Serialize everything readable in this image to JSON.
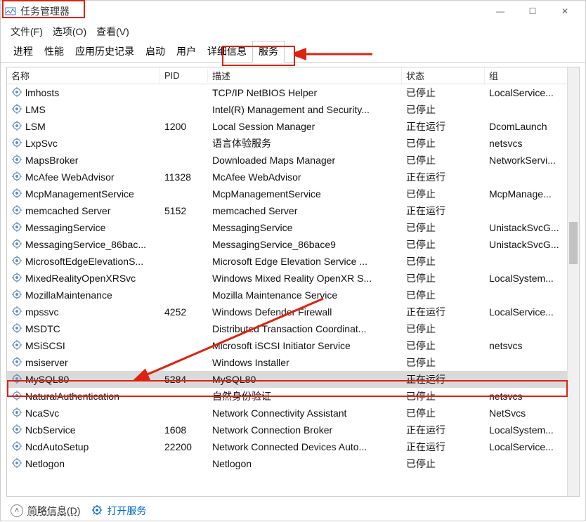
{
  "window": {
    "title": "任务管理器",
    "minimize": "—",
    "maximize": "☐",
    "close": "✕"
  },
  "menubar": {
    "file": "文件(F)",
    "options": "选项(O)",
    "view": "查看(V)"
  },
  "tabs": {
    "processes": "进程",
    "performance": "性能",
    "app_history": "应用历史记录",
    "startup": "启动",
    "users": "用户",
    "details": "详细信息",
    "services": "服务"
  },
  "columns": {
    "name": "名称",
    "pid": "PID",
    "description": "描述",
    "status": "状态",
    "group": "组"
  },
  "status_labels": {
    "stopped": "已停止",
    "running": "正在运行"
  },
  "services": [
    {
      "name": "lmhosts",
      "pid": "",
      "desc": "TCP/IP NetBIOS Helper",
      "status": "已停止",
      "group": "LocalService..."
    },
    {
      "name": "LMS",
      "pid": "",
      "desc": "Intel(R) Management and Security...",
      "status": "已停止",
      "group": ""
    },
    {
      "name": "LSM",
      "pid": "1200",
      "desc": "Local Session Manager",
      "status": "正在运行",
      "group": "DcomLaunch"
    },
    {
      "name": "LxpSvc",
      "pid": "",
      "desc": "语言体验服务",
      "status": "已停止",
      "group": "netsvcs"
    },
    {
      "name": "MapsBroker",
      "pid": "",
      "desc": "Downloaded Maps Manager",
      "status": "已停止",
      "group": "NetworkServi..."
    },
    {
      "name": "McAfee WebAdvisor",
      "pid": "11328",
      "desc": "McAfee WebAdvisor",
      "status": "正在运行",
      "group": ""
    },
    {
      "name": "McpManagementService",
      "pid": "",
      "desc": "McpManagementService",
      "status": "已停止",
      "group": "McpManage..."
    },
    {
      "name": "memcached Server",
      "pid": "5152",
      "desc": "memcached Server",
      "status": "正在运行",
      "group": ""
    },
    {
      "name": "MessagingService",
      "pid": "",
      "desc": "MessagingService",
      "status": "已停止",
      "group": "UnistackSvcG..."
    },
    {
      "name": "MessagingService_86bac...",
      "pid": "",
      "desc": "MessagingService_86bace9",
      "status": "已停止",
      "group": "UnistackSvcG..."
    },
    {
      "name": "MicrosoftEdgeElevationS...",
      "pid": "",
      "desc": "Microsoft Edge Elevation Service ...",
      "status": "已停止",
      "group": ""
    },
    {
      "name": "MixedRealityOpenXRSvc",
      "pid": "",
      "desc": "Windows Mixed Reality OpenXR S...",
      "status": "已停止",
      "group": "LocalSystem..."
    },
    {
      "name": "MozillaMaintenance",
      "pid": "",
      "desc": "Mozilla Maintenance Service",
      "status": "已停止",
      "group": ""
    },
    {
      "name": "mpssvc",
      "pid": "4252",
      "desc": "Windows Defender Firewall",
      "status": "正在运行",
      "group": "LocalService..."
    },
    {
      "name": "MSDTC",
      "pid": "",
      "desc": "Distributed Transaction Coordinat...",
      "status": "已停止",
      "group": ""
    },
    {
      "name": "MSiSCSI",
      "pid": "",
      "desc": "Microsoft iSCSI Initiator Service",
      "status": "已停止",
      "group": "netsvcs"
    },
    {
      "name": "msiserver",
      "pid": "",
      "desc": "Windows Installer",
      "status": "已停止",
      "group": ""
    },
    {
      "name": "MySQL80",
      "pid": "5284",
      "desc": "MySQL80",
      "status": "正在运行",
      "group": "",
      "selected": true
    },
    {
      "name": "NaturalAuthentication",
      "pid": "",
      "desc": "自然身份验证",
      "status": "已停止",
      "group": "netsvcs"
    },
    {
      "name": "NcaSvc",
      "pid": "",
      "desc": "Network Connectivity Assistant",
      "status": "已停止",
      "group": "NetSvcs"
    },
    {
      "name": "NcbService",
      "pid": "1608",
      "desc": "Network Connection Broker",
      "status": "正在运行",
      "group": "LocalSystem..."
    },
    {
      "name": "NcdAutoSetup",
      "pid": "22200",
      "desc": "Network Connected Devices Auto...",
      "status": "正在运行",
      "group": "LocalService..."
    },
    {
      "name": "Netlogon",
      "pid": "",
      "desc": "Netlogon",
      "status": "已停止",
      "group": ""
    }
  ],
  "footer": {
    "fewer_details": "简略信息(D)",
    "open_services": "打开服务"
  }
}
